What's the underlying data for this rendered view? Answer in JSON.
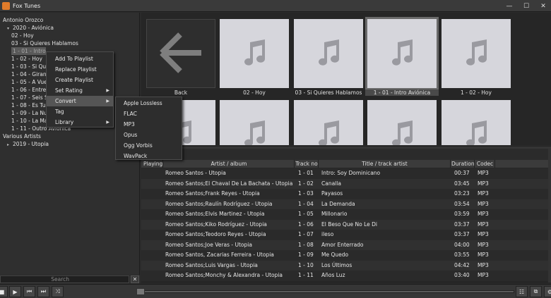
{
  "window": {
    "title": "Fox Tunes"
  },
  "tree": {
    "items": [
      {
        "label": "Antonio Orozco",
        "arrow": "",
        "indent": 0
      },
      {
        "label": "2020 - Aviónica",
        "arrow": "▾",
        "indent": 1
      },
      {
        "label": "02 - Hoy",
        "arrow": "",
        "indent": 2
      },
      {
        "label": "03 - Si Quieres Hablamos",
        "arrow": "",
        "indent": 2
      },
      {
        "label": "1 - 01 - Intro",
        "arrow": "",
        "indent": 2,
        "selected": true
      },
      {
        "label": "1 - 02 - Hoy",
        "arrow": "",
        "indent": 2
      },
      {
        "label": "1 - 03 - Si Qu",
        "arrow": "",
        "indent": 2
      },
      {
        "label": "1 - 04 - Giran",
        "arrow": "",
        "indent": 2
      },
      {
        "label": "1 - 05 - A Vue",
        "arrow": "",
        "indent": 2
      },
      {
        "label": "1 - 06 - Entre",
        "arrow": "",
        "indent": 2
      },
      {
        "label": "1 - 07 - Seis S",
        "arrow": "",
        "indent": 2
      },
      {
        "label": "1 - 08 - Es Tu",
        "arrow": "",
        "indent": 2
      },
      {
        "label": "1 - 09 - La Nu",
        "arrow": "",
        "indent": 2
      },
      {
        "label": "1 - 10 - La Ma",
        "arrow": "",
        "indent": 2
      },
      {
        "label": "1 - 11 - Outro Aviónica",
        "arrow": "",
        "indent": 2
      },
      {
        "label": "Various Artists",
        "arrow": "",
        "indent": 0
      },
      {
        "label": "2019 - Utopia",
        "arrow": "▸",
        "indent": 1
      }
    ]
  },
  "search": {
    "placeholder": "Search",
    "clear_label": "✕"
  },
  "context_menu": {
    "items": [
      {
        "label": "Add To Playlist",
        "has_sub": false
      },
      {
        "label": "Replace Playlist",
        "has_sub": false
      },
      {
        "label": "Create Playlist",
        "has_sub": false
      },
      {
        "label": "Set Rating",
        "has_sub": true
      },
      {
        "label": "Convert",
        "has_sub": true,
        "highlighted": true
      },
      {
        "label": "Tag",
        "has_sub": false
      },
      {
        "label": "Library",
        "has_sub": true
      }
    ],
    "submenu": [
      "Apple Lossless",
      "FLAC",
      "MP3",
      "Opus",
      "Ogg Vorbis",
      "WavPack"
    ]
  },
  "grid": {
    "tiles": [
      {
        "label": "Back",
        "type": "back"
      },
      {
        "label": "02 - Hoy",
        "type": "note"
      },
      {
        "label": "03 - Si Quieres Hablamos",
        "type": "note"
      },
      {
        "label": "1 - 01 - Intro Aviónica",
        "type": "note",
        "selected": true
      },
      {
        "label": "1 - 02 - Hoy",
        "type": "note"
      }
    ],
    "second_row_count": 5
  },
  "table": {
    "columns": [
      "Playing",
      "Artist / album",
      "Track no",
      "Title / track artist",
      "Duration",
      "Codec"
    ],
    "rows": [
      {
        "artist": "Romeo Santos - Utopia",
        "no": "1 - 01",
        "title": "Intro: Soy Dominicano",
        "duration": "00:37",
        "codec": "MP3"
      },
      {
        "artist": "Romeo Santos;El Chaval De La Bachata - Utopia",
        "no": "1 - 02",
        "title": "Canalla",
        "duration": "03:45",
        "codec": "MP3"
      },
      {
        "artist": "Romeo Santos;Frank Reyes - Utopia",
        "no": "1 - 03",
        "title": "Payasos",
        "duration": "03:23",
        "codec": "MP3"
      },
      {
        "artist": "Romeo Santos;Raulín Rodríguez - Utopia",
        "no": "1 - 04",
        "title": "La Demanda",
        "duration": "03:54",
        "codec": "MP3"
      },
      {
        "artist": "Romeo Santos;Elvis Martinez - Utopia",
        "no": "1 - 05",
        "title": "Millonario",
        "duration": "03:59",
        "codec": "MP3"
      },
      {
        "artist": "Romeo Santos;Kiko Rodríguez - Utopia",
        "no": "1 - 06",
        "title": "El Beso Que No Le Di",
        "duration": "03:37",
        "codec": "MP3"
      },
      {
        "artist": "Romeo Santos;Teodoro Reyes - Utopia",
        "no": "1 - 07",
        "title": "ileso",
        "duration": "03:37",
        "codec": "MP3"
      },
      {
        "artist": "Romeo Santos;Joe Veras - Utopia",
        "no": "1 - 08",
        "title": "Amor Enterrado",
        "duration": "04:00",
        "codec": "MP3"
      },
      {
        "artist": "Romeo Santos, Zacarias Ferreira - Utopia",
        "no": "1 - 09",
        "title": "Me Quedo",
        "duration": "03:55",
        "codec": "MP3"
      },
      {
        "artist": "Romeo Santos;Luis Vargas - Utopia",
        "no": "1 - 10",
        "title": "Los Últimos",
        "duration": "04:42",
        "codec": "MP3"
      },
      {
        "artist": "Romeo Santos;Monchy & Alexandra - Utopia",
        "no": "1 - 11",
        "title": "Años Luz",
        "duration": "03:40",
        "codec": "MP3"
      }
    ]
  },
  "transport": {
    "buttons": [
      {
        "name": "stop-icon",
        "glyph": "■"
      },
      {
        "name": "play-icon",
        "glyph": "▶"
      },
      {
        "name": "previous-icon",
        "glyph": "⏮"
      },
      {
        "name": "next-icon",
        "glyph": "⏭"
      },
      {
        "name": "shuffle-icon",
        "glyph": "⤨"
      }
    ],
    "right_buttons": [
      {
        "name": "equalizer-icon",
        "glyph": "☷"
      },
      {
        "name": "mini-player-icon",
        "glyph": "⧉"
      },
      {
        "name": "settings-icon",
        "glyph": "⚙"
      }
    ]
  }
}
